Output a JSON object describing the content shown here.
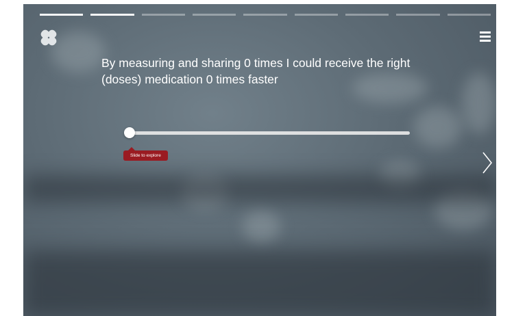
{
  "progress": {
    "total_steps": 9,
    "active_steps": [
      1,
      2
    ]
  },
  "icons": {
    "logo": "logo-icon",
    "menu": "hamburger-menu-icon",
    "next": "chevron-right-icon"
  },
  "main": {
    "headline": "By measuring and sharing 0 times I could receive the right (doses) medication 0 times faster",
    "slider": {
      "value": 0,
      "tooltip": "Slide to explore"
    }
  },
  "colors": {
    "tooltip_bg": "#9a1b22",
    "text": "#ffffff",
    "background": "#5d6b75"
  }
}
